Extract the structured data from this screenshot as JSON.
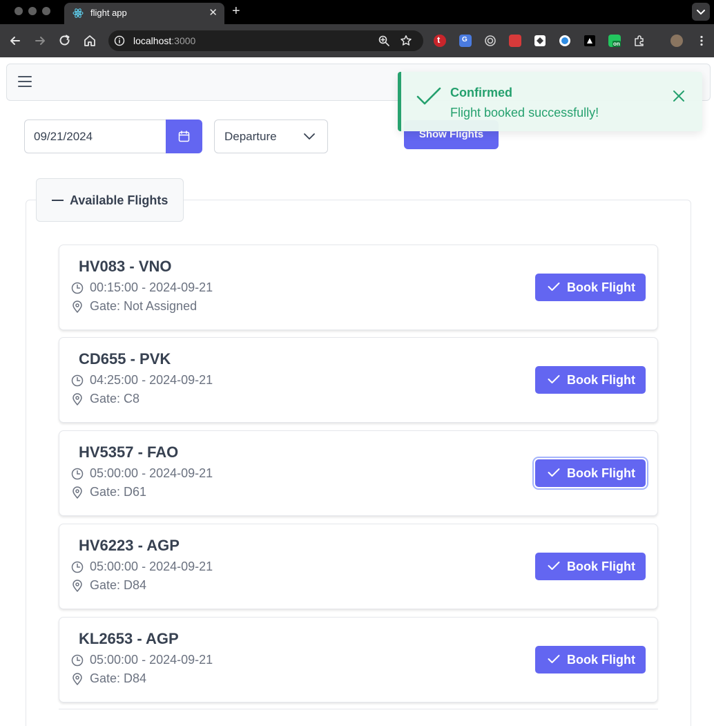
{
  "browser": {
    "tab_title": "flight app",
    "tab_close": "✕",
    "new_tab": "+",
    "url_host": "localhost",
    "url_port": ":3000",
    "icons": [
      "back-icon",
      "forward-icon",
      "reload-icon",
      "home-icon",
      "site-info-icon",
      "zoom-icon",
      "bookmark-star-icon",
      "menu-dots-icon"
    ],
    "extensions": [
      "extension-t-icon",
      "google-translate-icon",
      "target-icon",
      "red-extension-icon",
      "white-extension-icon",
      "blue-extension-icon",
      "black-extension-icon",
      "green-on-extension-icon",
      "puzzle-icon",
      "profile-avatar-icon"
    ]
  },
  "header": {
    "menu_icon": "hamburger-icon"
  },
  "filters": {
    "date_value": "09/21/2024",
    "calendar_icon": "calendar-icon",
    "direction_selected": "Departure",
    "show_button": "Show Flights"
  },
  "flights_panel": {
    "legend": "Available Flights",
    "book_label": "Book Flight",
    "gate_prefix": "Gate: ",
    "flights": [
      {
        "code": "HV083 - VNO",
        "time": "00:15:00 - 2024-09-21",
        "gate": "Gate: Not Assigned"
      },
      {
        "code": "CD655 - PVK",
        "time": "04:25:00 - 2024-09-21",
        "gate": "Gate: C8"
      },
      {
        "code": "HV5357 - FAO",
        "time": "05:00:00 - 2024-09-21",
        "gate": "Gate: D61"
      },
      {
        "code": "HV6223 - AGP",
        "time": "05:00:00 - 2024-09-21",
        "gate": "Gate: D84"
      },
      {
        "code": "KL2653 - AGP",
        "time": "05:00:00 - 2024-09-21",
        "gate": "Gate: D84"
      }
    ]
  },
  "toast": {
    "summary": "Confirmed",
    "detail": "Flight booked successfully!"
  },
  "colors": {
    "primary": "#6366f1",
    "success": "#1e9e6a",
    "success_bg": "#ebf8f2",
    "text": "#374151",
    "muted": "#6b7280"
  }
}
